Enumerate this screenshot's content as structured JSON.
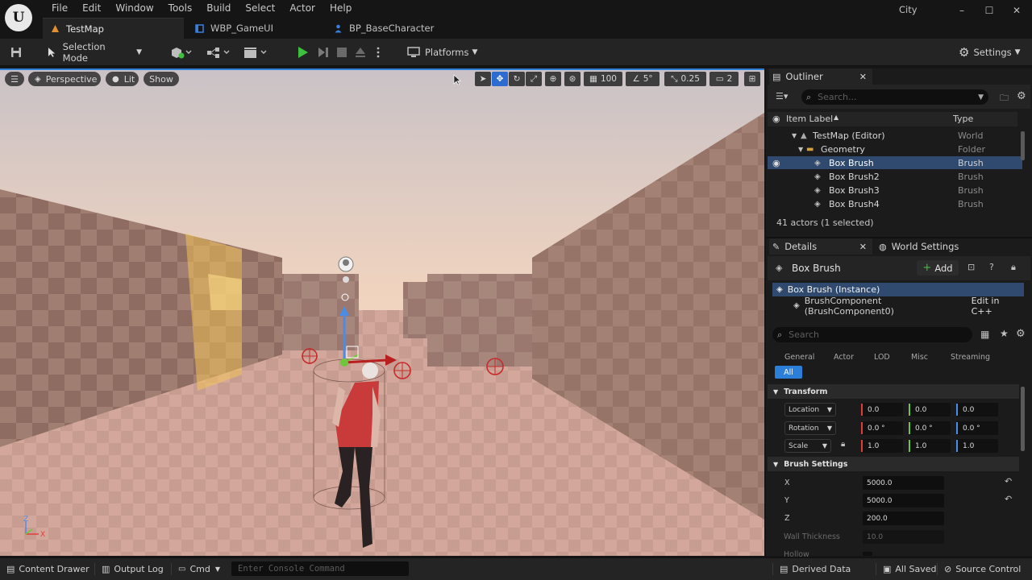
{
  "app": {
    "logo_glyph": "U",
    "project_name": "City",
    "window_controls": [
      "–",
      "☐",
      "✕"
    ]
  },
  "menu": [
    "File",
    "Edit",
    "Window",
    "Tools",
    "Build",
    "Select",
    "Actor",
    "Help"
  ],
  "doc_tabs": [
    {
      "label": "TestMap",
      "icon": "level-icon",
      "active": true
    },
    {
      "label": "WBP_GameUI",
      "icon": "widget-blueprint-icon",
      "active": false
    },
    {
      "label": "BP_BaseCharacter",
      "icon": "character-blueprint-icon",
      "active": false
    }
  ],
  "toolbar": {
    "mode_label": "Selection Mode",
    "platforms_label": "Platforms",
    "settings_label": "Settings"
  },
  "viewport": {
    "perspective_label": "Perspective",
    "lit_label": "Lit",
    "show_label": "Show",
    "grid_snap": "100",
    "rotation_snap": "5°",
    "scale_snap": "0.25",
    "camera_speed": "2",
    "axis_labels": {
      "z": "Z",
      "x": "X"
    }
  },
  "outliner": {
    "title": "Outliner",
    "search_placeholder": "Search...",
    "col_label": "Item Label",
    "col_type": "Type",
    "rows": [
      {
        "label": "TestMap (Editor)",
        "type": "World"
      },
      {
        "label": "Geometry",
        "type": "Folder"
      },
      {
        "label": "Box Brush",
        "type": "Brush"
      },
      {
        "label": "Box Brush2",
        "type": "Brush"
      },
      {
        "label": "Box Brush3",
        "type": "Brush"
      },
      {
        "label": "Box Brush4",
        "type": "Brush"
      }
    ],
    "status": "41 actors (1 selected)"
  },
  "details": {
    "tab_label": "Details",
    "world_settings_label": "World Settings",
    "actor_name": "Box Brush",
    "add_label": "Add",
    "instance_label": "Box Brush (Instance)",
    "component_label": "BrushComponent (BrushComponent0)",
    "edit_cpp_label": "Edit in C++",
    "search_placeholder": "Search",
    "categories": [
      "General",
      "Actor",
      "LOD",
      "Misc",
      "Streaming",
      "All"
    ],
    "transform": {
      "section": "Transform",
      "location": {
        "label": "Location",
        "x": "0.0",
        "y": "0.0",
        "z": "0.0"
      },
      "rotation": {
        "label": "Rotation",
        "x": "0.0 °",
        "y": "0.0 °",
        "z": "0.0 °"
      },
      "scale": {
        "label": "Scale",
        "x": "1.0",
        "y": "1.0",
        "z": "1.0"
      }
    },
    "brush_settings": {
      "section": "Brush Settings",
      "x": {
        "label": "X",
        "value": "5000.0"
      },
      "y": {
        "label": "Y",
        "value": "5000.0"
      },
      "z": {
        "label": "Z",
        "value": "200.0"
      },
      "wall": {
        "label": "Wall Thickness",
        "value": "10.0"
      },
      "hollow": {
        "label": "Hollow"
      }
    }
  },
  "bottombar": {
    "content_drawer": "Content Drawer",
    "output_log": "Output Log",
    "cmd": "Cmd",
    "console_placeholder": "Enter Console Command",
    "derived_data": "Derived Data",
    "all_saved": "All Saved",
    "source_control": "Source Control"
  },
  "colors": {
    "accent": "#2c7fd9",
    "selected_row": "#2f4a6e",
    "play_green": "#3fbf3f",
    "axis_x": "#e03c3c",
    "axis_y": "#6fc63a",
    "axis_z": "#4a8ce6"
  }
}
